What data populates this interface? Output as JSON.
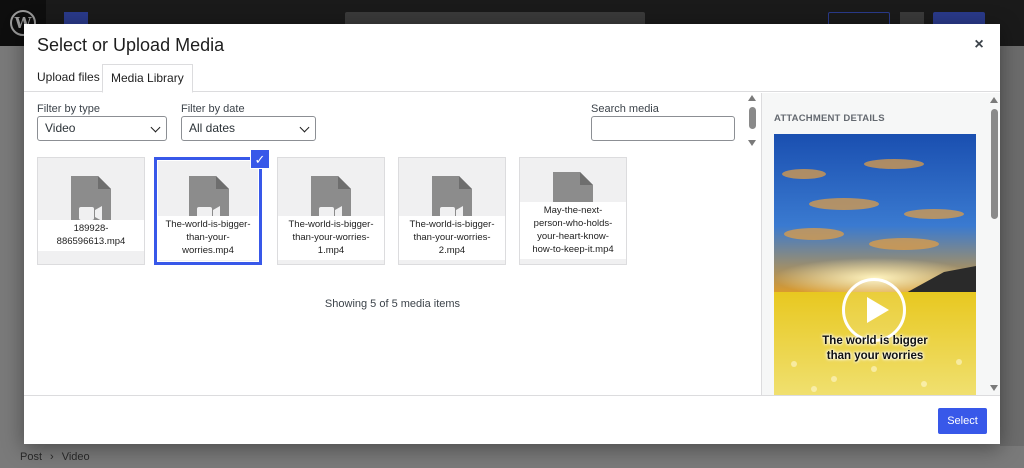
{
  "background": {
    "breadcrumb": [
      "Post",
      "Video"
    ],
    "breadcrumb_separator": "›"
  },
  "modal": {
    "title": "Select or Upload Media",
    "close_icon": "×",
    "tabs": [
      {
        "label": "Upload files",
        "active": false
      },
      {
        "label": "Media Library",
        "active": true
      }
    ]
  },
  "filters": {
    "type_label": "Filter by type",
    "type_value": "Video",
    "date_label": "Filter by date",
    "date_value": "All dates",
    "search_label": "Search media",
    "search_value": ""
  },
  "attachments": [
    {
      "name": "189928-886596613.mp4",
      "lines": [
        "189928-",
        "886596613.mp4"
      ],
      "selected": false
    },
    {
      "name": "The-world-is-bigger-than-your-worries.mp4",
      "lines": [
        "The-world-is-bigger-",
        "than-your-",
        "worries.mp4"
      ],
      "selected": true
    },
    {
      "name": "The-world-is-bigger-than-your-worries-1.mp4",
      "lines": [
        "The-world-is-bigger-",
        "than-your-worries-",
        "1.mp4"
      ],
      "selected": false
    },
    {
      "name": "The-world-is-bigger-than-your-worries-2.mp4",
      "lines": [
        "The-world-is-bigger-",
        "than-your-worries-",
        "2.mp4"
      ],
      "selected": false
    },
    {
      "name": "May-the-next-person-who-holds-your-heart-know-how-to-keep-it.mp4",
      "lines": [
        "May-the-next-",
        "person-who-holds-",
        "your-heart-know-",
        "how-to-keep-it.mp4"
      ],
      "selected": false
    }
  ],
  "media_count_text": "Showing 5 of 5 media items",
  "sidebar": {
    "heading": "ATTACHMENT DETAILS",
    "preview_caption_line1": "The world is bigger",
    "preview_caption_line2": "than your worries"
  },
  "footer": {
    "select_label": "Select"
  },
  "colors": {
    "accent": "#3858e9",
    "backdrop": "#7a7a7a"
  },
  "icons": {
    "file_icon": "video-file-icon",
    "check_icon": "check-icon",
    "play_icon": "play-icon"
  }
}
